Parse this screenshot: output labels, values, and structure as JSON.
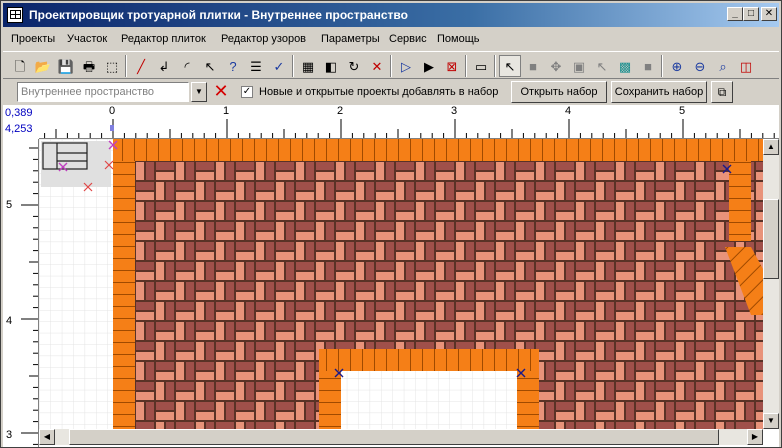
{
  "window": {
    "title": "Проектировщик тротуарной плитки - Внутреннее пространство",
    "controls": {
      "minimize": "_",
      "maximize": "□",
      "close": "✕"
    }
  },
  "menu": [
    "Проекты",
    "Участок",
    "Редактор плиток",
    "Редактор узоров",
    "Параметры",
    "Сервис",
    "Помощь"
  ],
  "toolbar": {
    "icons": [
      "new-file",
      "open-folder",
      "save",
      "print",
      "select-rect",
      "draw-line",
      "draw-polyline",
      "draw-arc",
      "select-pointer",
      "help",
      "list",
      "check",
      "grid",
      "color-fill",
      "rotate",
      "delete",
      "run-step",
      "run",
      "stop",
      "tile-view",
      "arrow-select",
      "fill-area",
      "move-node",
      "resize-area",
      "arrow-disabled",
      "texture",
      "gray-fill",
      "zoom-in",
      "zoom-out",
      "zoom-fit",
      "zoom-frame"
    ],
    "glyphs": [
      "🗋",
      "📂",
      "💾",
      "🖶",
      "⬚",
      "╱",
      "↲",
      "◜",
      "↖",
      "?",
      "☰",
      "✓",
      "▦",
      "◧",
      "↻",
      "✕",
      "▷",
      "▶",
      "⊠",
      "▭",
      "↖",
      "■",
      "✥",
      "▣",
      "↖",
      "▩",
      "■",
      "⊕",
      "⊖",
      "⌕",
      "◫"
    ]
  },
  "set_bar": {
    "combo_placeholder": "Внутреннее пространство",
    "checkbox_checked": true,
    "checkbox_label": "Новые и открытые проекты добавлять в набор",
    "open_set_button": "Открыть набор",
    "save_set_button": "Сохранить набор"
  },
  "canvas": {
    "coord_x": "0,389",
    "coord_y": "4,253",
    "h_ruler_labels": [
      "0",
      "1",
      "2",
      "3",
      "4",
      "5"
    ],
    "v_ruler_labels": [
      "5",
      "4",
      "3"
    ],
    "colors": {
      "border_tile": "#f57f17",
      "paver_light": "#e8937a",
      "paver_mid": "#a0504a",
      "paver_dark": "#5a3226",
      "grid": "#e4e4e4",
      "marker": "#c040c0"
    }
  }
}
